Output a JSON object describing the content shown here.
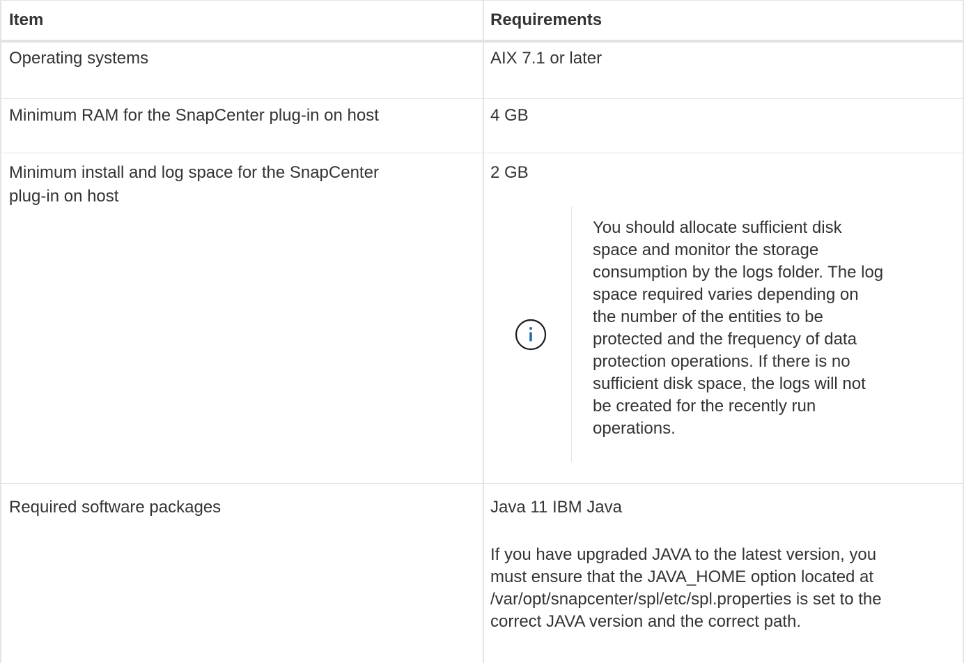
{
  "table": {
    "headers": [
      "Item",
      "Requirements"
    ],
    "rows": [
      {
        "item": "Operating systems",
        "requirement": "AIX 7.1 or later"
      },
      {
        "item": "Minimum RAM for the SnapCenter plug-in on host",
        "requirement": "4 GB"
      },
      {
        "item_lines": [
          "Minimum install and log space for the SnapCenter",
          "plug-in on host"
        ],
        "requirement": "2 GB",
        "note": {
          "icon": "info-icon",
          "lines": [
            "You should allocate sufficient disk",
            "space and monitor the storage",
            "consumption by the logs folder. The log",
            "space required varies depending on",
            "the number of the entities to be",
            "protected and the frequency of data",
            "protection operations. If there is no",
            "sufficient disk space, the logs will not",
            "be created for the recently run",
            "operations."
          ]
        }
      },
      {
        "item": "Required software packages",
        "requirement": "Java 11 IBM Java",
        "paragraph_lines": [
          "If you have upgraded JAVA to the latest version, you",
          "must ensure that the JAVA_HOME option located at",
          "/var/opt/snapcenter/spl/etc/spl.properties is set to the",
          "correct JAVA version and the correct path."
        ]
      }
    ]
  },
  "colors": {
    "text": "#333333",
    "border": "#e4e4e4",
    "icon": "#1a6fb5"
  }
}
